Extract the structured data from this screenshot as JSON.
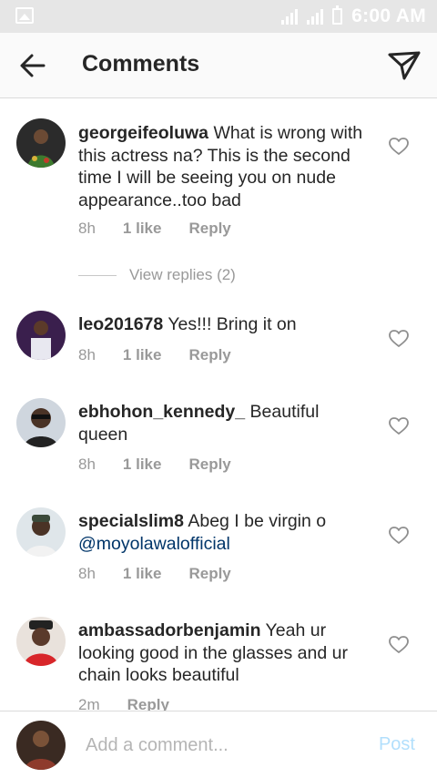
{
  "status_bar": {
    "time": "6:00 AM"
  },
  "header": {
    "title": "Comments"
  },
  "comments": [
    {
      "username": "georgeifeoluwa",
      "text": " What is wrong with this actress na? This is the second time I will be seeing you on nude appearance..too bad",
      "time": "8h",
      "likes": "1 like",
      "reply": "Reply",
      "view_replies": "View replies (2)"
    },
    {
      "username": "leo201678",
      "text": " Yes!!! Bring it on",
      "time": "8h",
      "likes": "1 like",
      "reply": "Reply"
    },
    {
      "username": "ebhohon_kennedy_",
      "text": " Beautiful queen",
      "time": "8h",
      "likes": "1 like",
      "reply": "Reply"
    },
    {
      "username": "specialslim8",
      "text": " Abeg I be virgin o ",
      "mention": "@moyolawalofficial",
      "time": "8h",
      "likes": "1 like",
      "reply": "Reply"
    },
    {
      "username": "ambassadorbenjamin",
      "text": " Yeah ur looking good in the glasses and ur chain looks beautiful",
      "time": "2m",
      "reply": "Reply"
    }
  ],
  "composer": {
    "placeholder": "Add a comment...",
    "post_label": "Post"
  },
  "colors": {
    "accent_link": "#003569",
    "post_disabled": "#b2dffc",
    "meta_gray": "#999999"
  }
}
